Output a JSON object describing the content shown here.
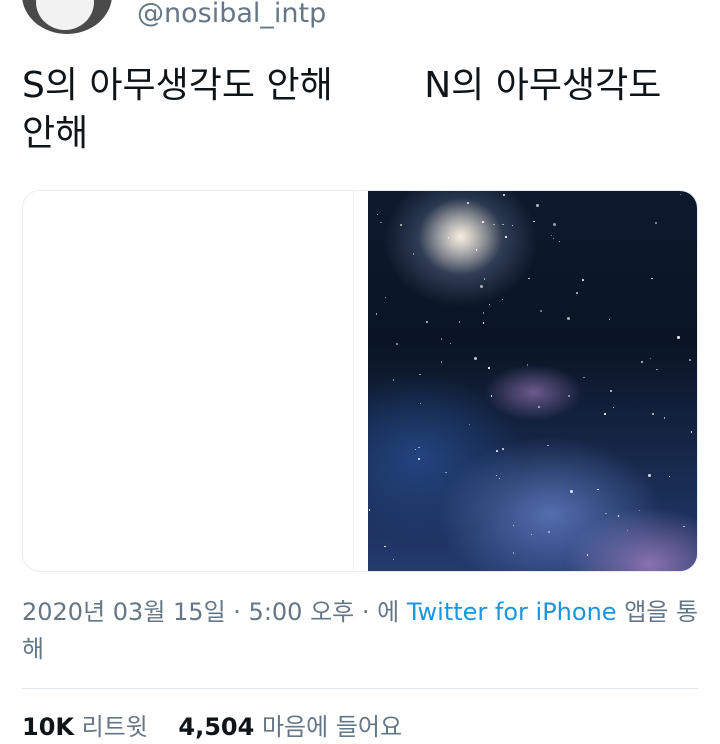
{
  "author": {
    "handle": "@nosibal_intp",
    "avatar_icon": "cartoon-face-avatar"
  },
  "tweet": {
    "text": "S의 아무생각도 안해        N의 아무생각도 안해"
  },
  "media": {
    "left_panel_desc": "blank-white-image",
    "right_panel_desc": "galaxy-space-image"
  },
  "meta": {
    "date": "2020년 03월 15일",
    "sep1": " · ",
    "time": "5:00 오후",
    "sep2": " · ",
    "via_prefix": "에 ",
    "source": "Twitter for iPhone",
    "via_suffix": " 앱을 통해"
  },
  "stats": {
    "retweets_count": "10K",
    "retweets_label": "리트윗",
    "likes_count": "4,504",
    "likes_label": "마음에 들어요"
  },
  "colors": {
    "link": "#1b95e0",
    "muted": "#657786",
    "text": "#0f1419"
  }
}
